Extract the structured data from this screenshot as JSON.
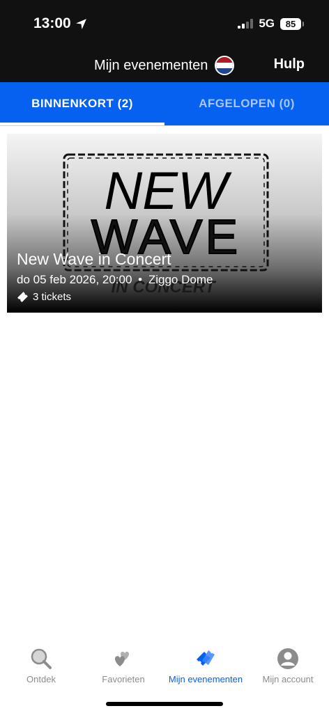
{
  "status": {
    "time": "13:00",
    "network": "5G",
    "battery": "85"
  },
  "header": {
    "title": "Mijn evenementen",
    "help_label": "Hulp"
  },
  "tabs": [
    {
      "label": "BINNENKORT (2)",
      "active": true
    },
    {
      "label": "AFGELOPEN (0)",
      "active": false
    }
  ],
  "event": {
    "art_line1": "NEW",
    "art_line2": "WAVE",
    "art_line3": "IN CONCERT",
    "title": "New Wave in Concert",
    "datetime": "do 05 feb 2026, 20:00",
    "separator": "•",
    "venue": "Ziggo Dome",
    "tickets": "3 tickets"
  },
  "nav": [
    {
      "label": "Ontdek",
      "icon": "search-icon",
      "active": false
    },
    {
      "label": "Favorieten",
      "icon": "hearts-icon",
      "active": false
    },
    {
      "label": "Mijn evenementen",
      "icon": "tickets-icon",
      "active": true
    },
    {
      "label": "Mijn account",
      "icon": "account-icon",
      "active": false
    }
  ],
  "colors": {
    "brand_blue": "#0660f0",
    "header_bg": "#111111",
    "nav_inactive": "#8c8c8c"
  }
}
